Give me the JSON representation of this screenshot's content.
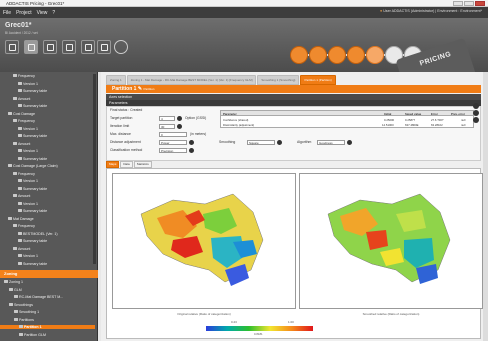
{
  "window": {
    "title": "ADDACTIS Pricing - Grec01*"
  },
  "menu": {
    "items": [
      "File",
      "Project",
      "View",
      "?"
    ],
    "user": "User ADDACTIS (Administrator) | Environment : Environment*"
  },
  "project": {
    "name": "Grec01*",
    "subtitle": "B/ Accident / 2012 / set"
  },
  "brand": {
    "logo_text": "PRICING",
    "accent_color": "#f07c15"
  },
  "sidebar": {
    "items": [
      {
        "label": "Frequency",
        "indent": 1
      },
      {
        "label": "Version 1",
        "indent": 2
      },
      {
        "label": "Summary table",
        "indent": 2
      },
      {
        "label": "Amount",
        "indent": 1
      },
      {
        "label": "Summary table",
        "indent": 2
      },
      {
        "label": "Cost Damage",
        "indent": 0
      },
      {
        "label": "Frequency",
        "indent": 1
      },
      {
        "label": "Version 1",
        "indent": 2
      },
      {
        "label": "Summary table",
        "indent": 2
      },
      {
        "label": "Amount",
        "indent": 1
      },
      {
        "label": "Version 1",
        "indent": 2
      },
      {
        "label": "Summary table",
        "indent": 2
      },
      {
        "label": "Cost Damage (Large Claim)",
        "indent": 0
      },
      {
        "label": "Frequency",
        "indent": 1
      },
      {
        "label": "Version 1",
        "indent": 2
      },
      {
        "label": "Summary table",
        "indent": 2
      },
      {
        "label": "Amount",
        "indent": 1
      },
      {
        "label": "Version 1",
        "indent": 2
      },
      {
        "label": "Summary table",
        "indent": 2
      },
      {
        "label": "Mat Damage",
        "indent": 0
      },
      {
        "label": "Frequency",
        "indent": 1
      },
      {
        "label": "BESTMODEL (Ver. 1)",
        "indent": 2
      },
      {
        "label": "Summary table",
        "indent": 2
      },
      {
        "label": "Amount",
        "indent": 1
      },
      {
        "label": "Version 1",
        "indent": 2
      },
      {
        "label": "Summary table",
        "indent": 2
      }
    ],
    "zoning_section": "Zoning",
    "zoning_items": [
      {
        "label": "Zoning 1",
        "indent": 0
      },
      {
        "label": "GLM",
        "indent": 1
      },
      {
        "label": "RC-Mat Damage BEST M...",
        "indent": 2
      },
      {
        "label": "Smoothings",
        "indent": 1
      },
      {
        "label": "Smoothing 1",
        "indent": 2
      },
      {
        "label": "Partitions",
        "indent": 2
      },
      {
        "label": "Partition 1",
        "indent": 3
      },
      {
        "label": "Partition GLM",
        "indent": 3
      }
    ],
    "selected": "Partition 1"
  },
  "tabs": [
    {
      "label": "Zoning 1",
      "active": false
    },
    {
      "label": "Zoning 1 - Mat Damage - RC-Mat Damage BEST MODEL (Ver. 1) (Ver. 1) [Frequency GLM]",
      "active": false
    },
    {
      "label": "Smoothing 1 (Smoothing)",
      "active": false
    },
    {
      "label": "Partition 1 (Partition)",
      "active": true
    }
  ],
  "partition": {
    "title": "Partition 1",
    "edit_hint": "Partition"
  },
  "axes_selection": "Axes selection",
  "parameters": {
    "header": "Parameters",
    "rows": {
      "row1_label": "Final status : Created",
      "target_partition_label": "Target partition",
      "target_partition_value": "4",
      "option_label": "Option (GSSI)",
      "iteration_limit_label": "Iteration limit",
      "iteration_limit_value": "30",
      "max_distance_label": "Max. distance",
      "max_distance_value": "0",
      "max_distance_unit": "(in meters)",
      "distance_adjustment_label": "Distance adjustment",
      "distance_adjustment_value": "Power",
      "smoothing_label": "Smoothing",
      "smoothing_value": "Square",
      "algorithm_label": "Algorithm",
      "algorithm_value": "Goodness",
      "classification_label": "Classification method",
      "classification_value": "Precision"
    },
    "table": {
      "headers": [
        "Parameter",
        "Initial",
        "Saved value",
        "Error",
        "Prev. error"
      ],
      "rows": [
        [
          "Confidence (shared)",
          "0.25000",
          "0.25877",
          "27.6 ?00?",
          "null"
        ],
        [
          "Dissimilarity (adjustment)",
          "14.51000",
          "637.4800E",
          "63.28102",
          "null"
        ]
      ]
    }
  },
  "subtabs": [
    {
      "label": "Maps",
      "active": true
    },
    {
      "label": "Data",
      "active": false
    },
    {
      "label": "Statistics",
      "active": false
    }
  ],
  "maps": {
    "left_caption": "Original relative (Ratio of categorization)",
    "right_caption": "Smoothed relative (Ratio of categorization)",
    "legend_min": "0.23",
    "legend_max": "1.00",
    "legend_mid": "0.8181"
  }
}
